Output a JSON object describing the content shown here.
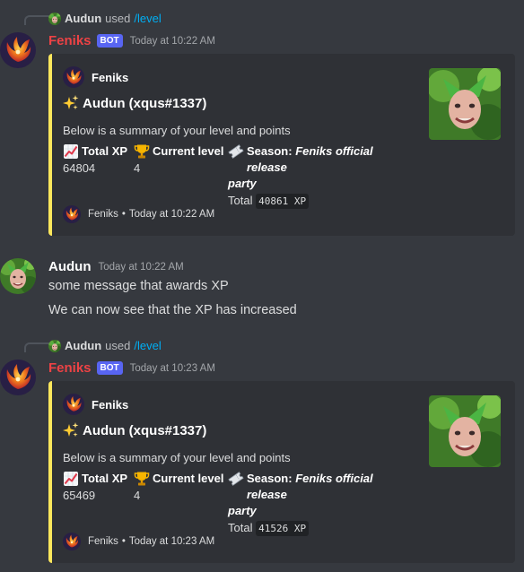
{
  "colors": {
    "background": "#36393f",
    "embed_bg": "#2f3136",
    "embed_accent": "#fee75c",
    "bot_name": "#ed4245",
    "bot_tag": "#5865f2",
    "command": "#00aff4"
  },
  "messages": [
    {
      "reply": {
        "user": "Audun",
        "verb": "used",
        "command": "/level"
      },
      "author": "Feniks",
      "bot_tag": "BOT",
      "timestamp": "Today at 10:22 AM",
      "embed": {
        "author": "Feniks",
        "title": "Audun (xqus#1337)",
        "description": "Below is a summary of your level and points",
        "fields": {
          "total_xp": {
            "name": "Total XP",
            "value": "64804"
          },
          "current_level": {
            "name": "Current level",
            "value": "4"
          },
          "season": {
            "name_prefix": "Season: ",
            "name_season": "Feniks official release",
            "name_season_cont": "party",
            "total_label": "Total",
            "total_value": "40861 XP"
          }
        },
        "footer": {
          "text": "Feniks",
          "separator": "•",
          "timestamp": "Today at 10:22 AM"
        }
      }
    },
    {
      "author": "Audun",
      "timestamp": "Today at 10:22 AM",
      "lines": [
        "some message that awards XP",
        "We can now see that the XP has increased"
      ]
    },
    {
      "reply": {
        "user": "Audun",
        "verb": "used",
        "command": "/level"
      },
      "author": "Feniks",
      "bot_tag": "BOT",
      "timestamp": "Today at 10:23 AM",
      "embed": {
        "author": "Feniks",
        "title": "Audun (xqus#1337)",
        "description": "Below is a summary of your level and points",
        "fields": {
          "total_xp": {
            "name": "Total XP",
            "value": "65469"
          },
          "current_level": {
            "name": "Current level",
            "value": "4"
          },
          "season": {
            "name_prefix": "Season: ",
            "name_season": "Feniks official release",
            "name_season_cont": "party",
            "total_label": "Total",
            "total_value": "41526 XP"
          }
        },
        "footer": {
          "text": "Feniks",
          "separator": "•",
          "timestamp": "Today at 10:23 AM"
        }
      }
    }
  ]
}
